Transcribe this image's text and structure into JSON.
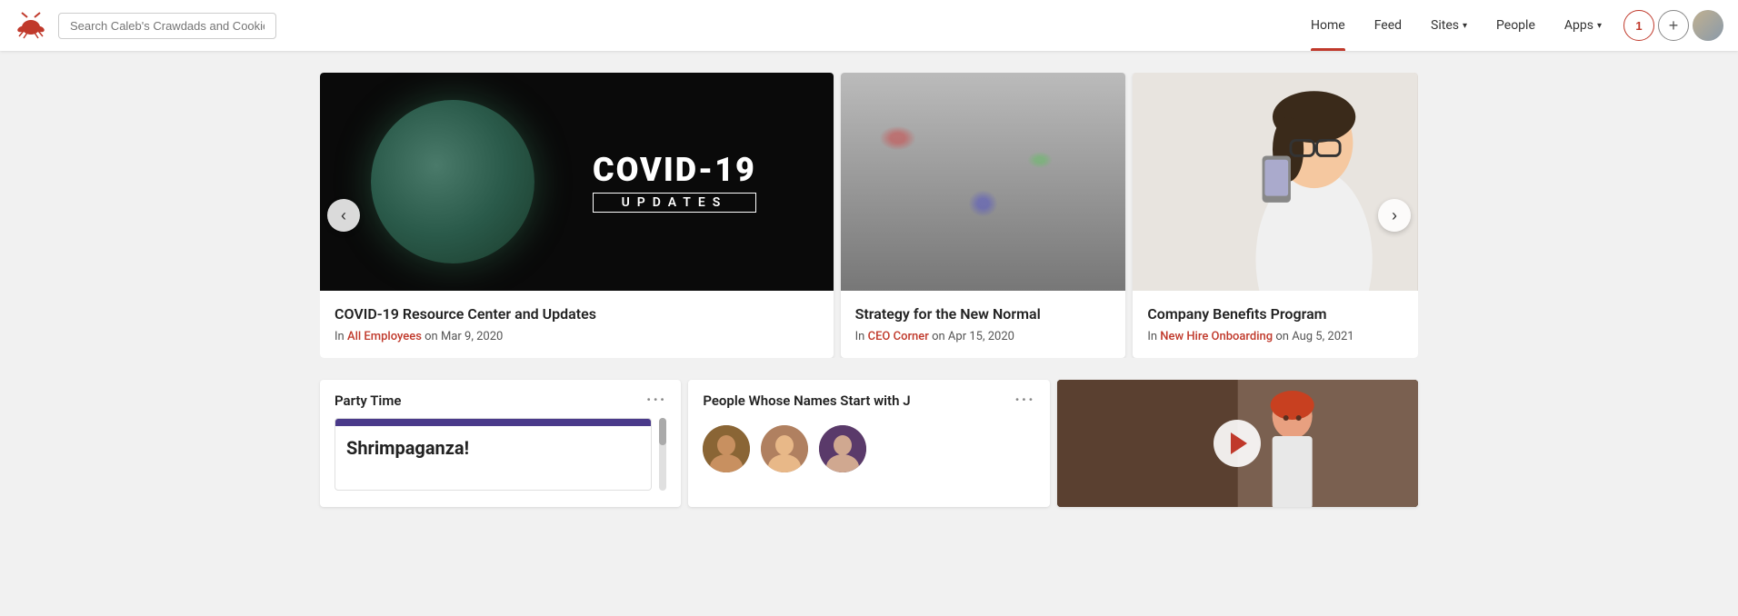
{
  "nav": {
    "search_placeholder": "Search Caleb's Crawdads and Cookies Intran...",
    "links": [
      {
        "label": "Home",
        "active": true
      },
      {
        "label": "Feed",
        "active": false
      },
      {
        "label": "Sites",
        "active": false,
        "has_dropdown": true
      },
      {
        "label": "People",
        "active": false
      },
      {
        "label": "Apps",
        "active": false,
        "has_dropdown": true
      }
    ],
    "notification_count": "1",
    "add_btn_label": "+",
    "logo_alt": "lobster-logo"
  },
  "featured_posts": [
    {
      "title": "COVID-19 Resource Center and Updates",
      "category": "All Employees",
      "date": "Mar 9, 2020",
      "img_type": "covid"
    },
    {
      "title": "Strategy for the New Normal",
      "category": "CEO Corner",
      "date": "Apr 15, 2020",
      "img_type": "crowd"
    },
    {
      "title": "Company Benefits Program",
      "category": "New Hire Onboarding",
      "date": "Aug 5, 2021",
      "img_type": "woman"
    }
  ],
  "widgets": {
    "party": {
      "title": "Party Time",
      "more_label": "···",
      "post_text": "Shrimpaganza!"
    },
    "people": {
      "title": "People Whose Names Start with J",
      "more_label": "···",
      "avatars": [
        {
          "color": "brown",
          "label": "Person J1"
        },
        {
          "color": "tan",
          "label": "Person J2"
        },
        {
          "color": "purple",
          "label": "Person J3"
        }
      ]
    },
    "video": {
      "has_play": true
    }
  },
  "carousel": {
    "prev_label": "‹",
    "next_label": "›"
  },
  "meta_in": "In",
  "meta_on": "on"
}
